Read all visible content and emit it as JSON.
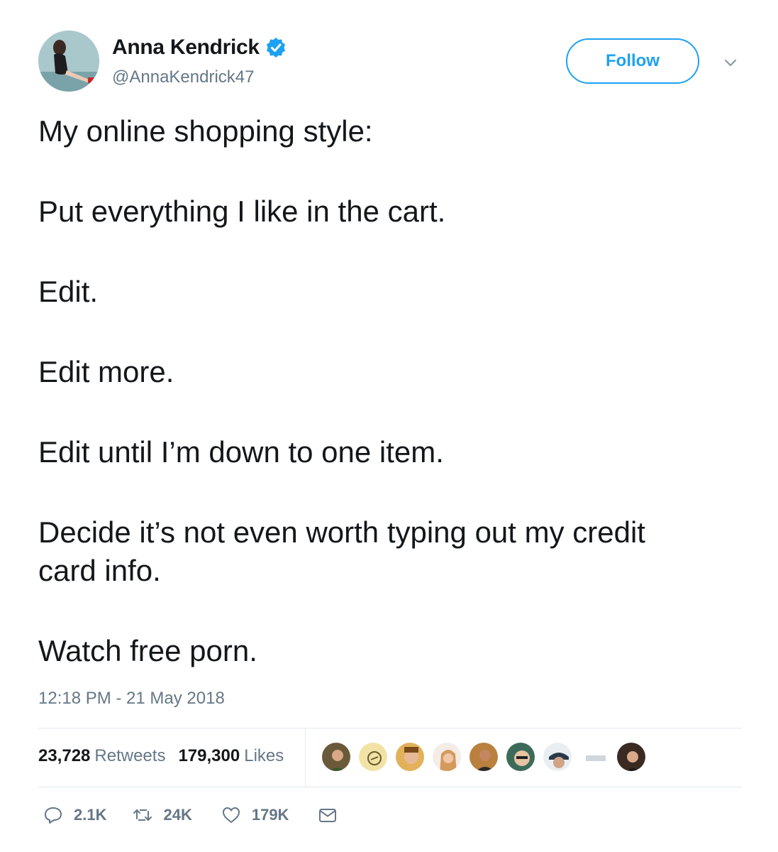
{
  "author": {
    "name": "Anna Kendrick",
    "handle": "@AnnaKendrick47",
    "verified": true
  },
  "follow_button": {
    "label": "Follow"
  },
  "tweet": {
    "lines": [
      "My online shopping style:",
      "Put everything I like in the cart.",
      "Edit.",
      "Edit more.",
      "Edit until I’m down to one item.",
      "Decide it’s not even worth typing out my credit card info.",
      "Watch free porn."
    ],
    "timestamp": "12:18 PM - 21 May 2018"
  },
  "stats": {
    "retweets_count": "23,728",
    "retweets_label": "Retweets",
    "likes_count": "179,300",
    "likes_label": "Likes"
  },
  "actions": {
    "replies": "2.1K",
    "retweets": "24K",
    "likes": "179K"
  },
  "colors": {
    "accent": "#1da1f2",
    "text": "#14171a",
    "muted": "#657786",
    "divider": "#e1e8ed"
  }
}
